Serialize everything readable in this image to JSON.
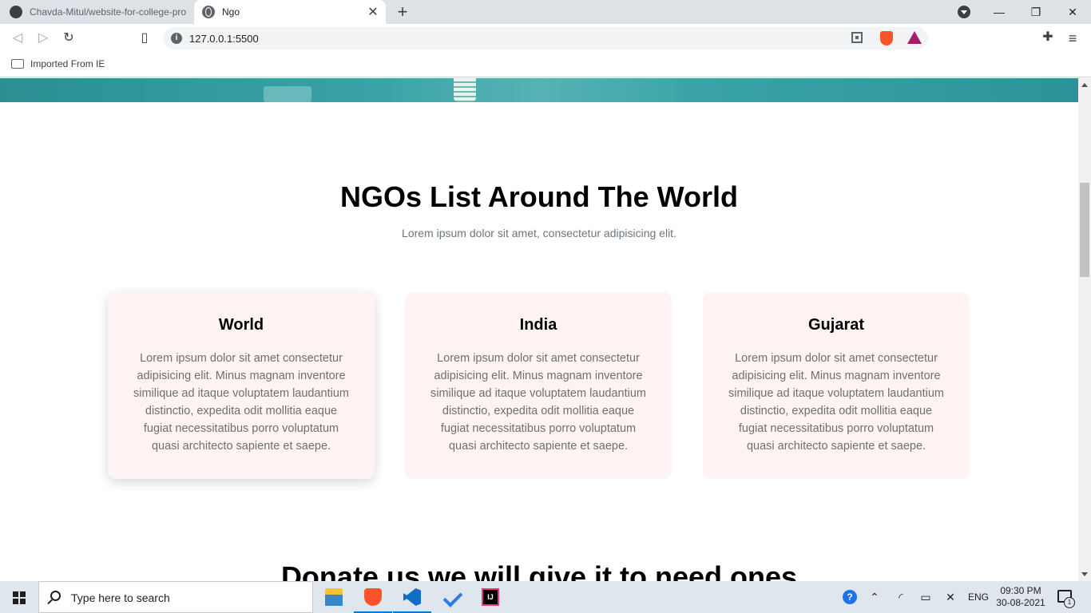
{
  "browser": {
    "tabs": [
      {
        "title": "Chavda-Mitul/website-for-college-pro",
        "active": false,
        "icon": "github-icon"
      },
      {
        "title": "Ngo",
        "active": true,
        "icon": "globe-icon"
      }
    ],
    "new_tab_label": "+",
    "window_controls": {
      "minimize": "—",
      "restore": "❐",
      "close": "✕"
    },
    "url": "127.0.0.1:5500",
    "bookmarks": [
      {
        "label": "Imported From IE",
        "icon": "folder-icon"
      }
    ]
  },
  "page": {
    "section_title": "NGOs List Around The World",
    "section_subtitle": "Lorem ipsum dolor sit amet, consectetur adipisicing elit.",
    "cards": [
      {
        "title": "World",
        "text": "Lorem ipsum dolor sit amet consectetur adipisicing elit. Minus magnam inventore similique ad itaque voluptatem laudantium distinctio, expedita odit mollitia eaque fugiat necessitatibus porro voluptatum quasi architecto sapiente et saepe."
      },
      {
        "title": "India",
        "text": "Lorem ipsum dolor sit amet consectetur adipisicing elit. Minus magnam inventore similique ad itaque voluptatem laudantium distinctio, expedita odit mollitia eaque fugiat necessitatibus porro voluptatum quasi architecto sapiente et saepe."
      },
      {
        "title": "Gujarat",
        "text": "Lorem ipsum dolor sit amet consectetur adipisicing elit. Minus magnam inventore similique ad itaque voluptatem laudantium distinctio, expedita odit mollitia eaque fugiat necessitatibus porro voluptatum quasi architecto sapiente et saepe."
      }
    ],
    "donate_title": "Donate us we will give it to need ones",
    "colors": {
      "card_bg": "#fff3f3",
      "hero_teal": "#3aa3a8",
      "body_text": "#6f6f6f"
    }
  },
  "taskbar": {
    "search_placeholder": "Type here to search",
    "apps": [
      "file-explorer-icon",
      "brave-icon",
      "vscode-icon",
      "todo-icon",
      "intellij-icon"
    ],
    "help_glyph": "?",
    "language": "ENG",
    "time": "09:30 PM",
    "date": "30-08-2021",
    "notification_count": "1"
  }
}
